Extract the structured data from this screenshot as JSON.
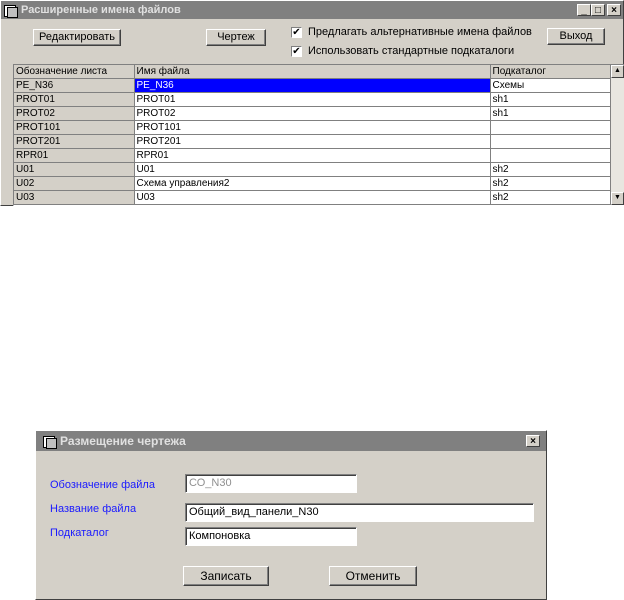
{
  "window1": {
    "title": "Расширенные имена файлов",
    "edit_button": "Редактировать",
    "drawing_button": "Чертеж",
    "exit_button": "Выход",
    "checkbox_alt_names": {
      "label": "Предлагать альтернативные имена файлов",
      "checked": true
    },
    "checkbox_std_dirs": {
      "label": "Использовать стандартные подкаталоги",
      "checked": true
    },
    "table": {
      "headers": [
        "Обозначение листа",
        "Имя файла",
        "Подкаталог"
      ],
      "rows": [
        [
          "PE_N36",
          "PE_N36",
          "Схемы"
        ],
        [
          "PROT01",
          "PROT01",
          "sh1"
        ],
        [
          "PROT02",
          "PROT02",
          "sh1"
        ],
        [
          "PROT101",
          "PROT101",
          ""
        ],
        [
          "PROT201",
          "PROT201",
          ""
        ],
        [
          "RPR01",
          "RPR01",
          ""
        ],
        [
          "U01",
          "U01",
          "sh2"
        ],
        [
          "U02",
          "Схема управления2",
          "sh2"
        ],
        [
          "U03",
          "U03",
          "sh2"
        ]
      ],
      "selected_row": 0
    }
  },
  "window2": {
    "title": "Размещение чертежа",
    "file_designation_label": "Обозначение файла",
    "file_designation_value": "СО_N30",
    "file_name_label": "Название файла",
    "file_name_value": "Общий_вид_панели_N30",
    "subdir_label": "Подкаталог",
    "subdir_value": "Компоновка",
    "save_button": "Записать",
    "cancel_button": "Отменить"
  },
  "icons": {
    "minimize": "minimize-icon",
    "maximize": "maximize-icon",
    "close": "close-icon",
    "check": "checkmark-icon",
    "scroll_up": "scroll-up-arrow-icon",
    "scroll_down": "scroll-down-arrow-icon"
  },
  "glyphs": {
    "minimize": "_",
    "maximize": "□",
    "close": "×",
    "check": "✔",
    "up": "▲",
    "down": "▼"
  }
}
